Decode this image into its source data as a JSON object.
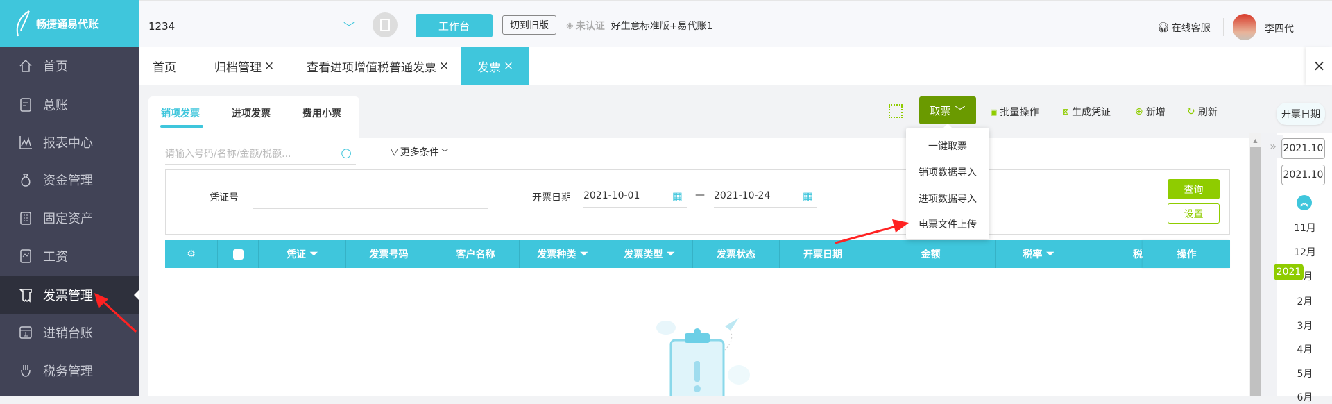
{
  "header": {
    "logo_text": "畅捷通易代账",
    "company": "1234",
    "workbench": "工作台",
    "switch_old": "切到旧版",
    "cert_status": "未认证",
    "product": "好生意标准版+易代账1",
    "support": "在线客服",
    "user": "李四代"
  },
  "sidebar": {
    "items": [
      {
        "label": "首页"
      },
      {
        "label": "总账"
      },
      {
        "label": "报表中心"
      },
      {
        "label": "资金管理"
      },
      {
        "label": "固定资产"
      },
      {
        "label": "工资"
      },
      {
        "label": "发票管理"
      },
      {
        "label": "进销台账"
      },
      {
        "label": "税务管理"
      }
    ]
  },
  "tabs": [
    {
      "label": "首页"
    },
    {
      "label": "归档管理",
      "close": "×"
    },
    {
      "label": "查看进项增值税普通发票",
      "close": "×"
    },
    {
      "label": "发票",
      "close": "×"
    }
  ],
  "tabs_close_all": "×",
  "subtabs": [
    {
      "label": "销项发票"
    },
    {
      "label": "进项发票"
    },
    {
      "label": "费用小票"
    }
  ],
  "search": {
    "placeholder": "请输入号码/名称/金额/税额...",
    "more": "更多条件"
  },
  "toolbar": {
    "fetch": "取票",
    "batch": "批量操作",
    "voucher": "生成凭证",
    "add": "新增",
    "refresh": "刷新"
  },
  "fetch_menu": [
    "一键取票",
    "销项数据导入",
    "进项数据导入",
    "电票文件上传"
  ],
  "filter": {
    "voucher_label": "凭证号",
    "voucher_value": "",
    "date_label": "开票日期",
    "date_from": "2021-10-01",
    "date_sep": "—",
    "date_to": "2021-10-24",
    "query": "查询",
    "settings": "设置"
  },
  "table": {
    "columns": [
      "凭证",
      "发票号码",
      "客户名称",
      "发票种类",
      "发票类型",
      "发票状态",
      "开票日期",
      "金额",
      "税率",
      "税",
      "操作"
    ]
  },
  "date_panel": {
    "title": "开票日期",
    "from": "2021.10",
    "to": "2021.10",
    "months_before": [
      "11月",
      "12月"
    ],
    "year_badge": "2021",
    "months_after": [
      "1月",
      "2月",
      "3月",
      "4月",
      "5月",
      "6月"
    ]
  },
  "colors": {
    "accent": "#3fc6dc",
    "sidebar": "#414356",
    "green": "#6a9a00",
    "lime": "#8fcc00"
  }
}
